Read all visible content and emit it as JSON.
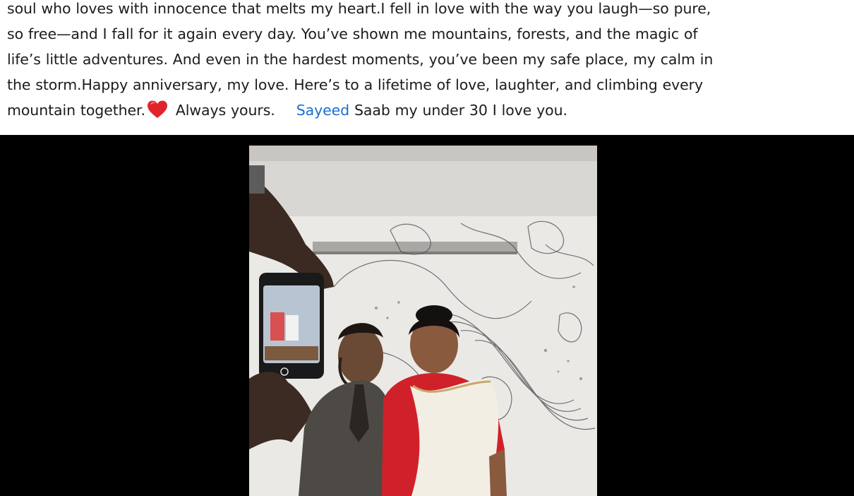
{
  "post": {
    "lines": [
      "soul who loves with innocence that melts my heart.I fell in love with the way you laugh—so pure,",
      "so free—and I fall for it again every day. You’ve shown me mountains, forests, and the magic of",
      "life’s little adventures. And even in the hardest moments, you’ve been my safe place, my calm in",
      "the storm.Happy anniversary, my love. Here’s to a lifetime of love, laughter, and climbing every"
    ],
    "last_line_before_heart": "mountain together.",
    "last_line_after_heart": " Always yours.",
    "mention": "Sayeed",
    "last_line_end": " Saab my under 30 I love you.",
    "heart_icon": "red-heart-emoji",
    "mention_color": "#1a6fd1"
  },
  "media": {
    "background_color": "#000000",
    "content_description_icon": "video-thumbnail"
  }
}
